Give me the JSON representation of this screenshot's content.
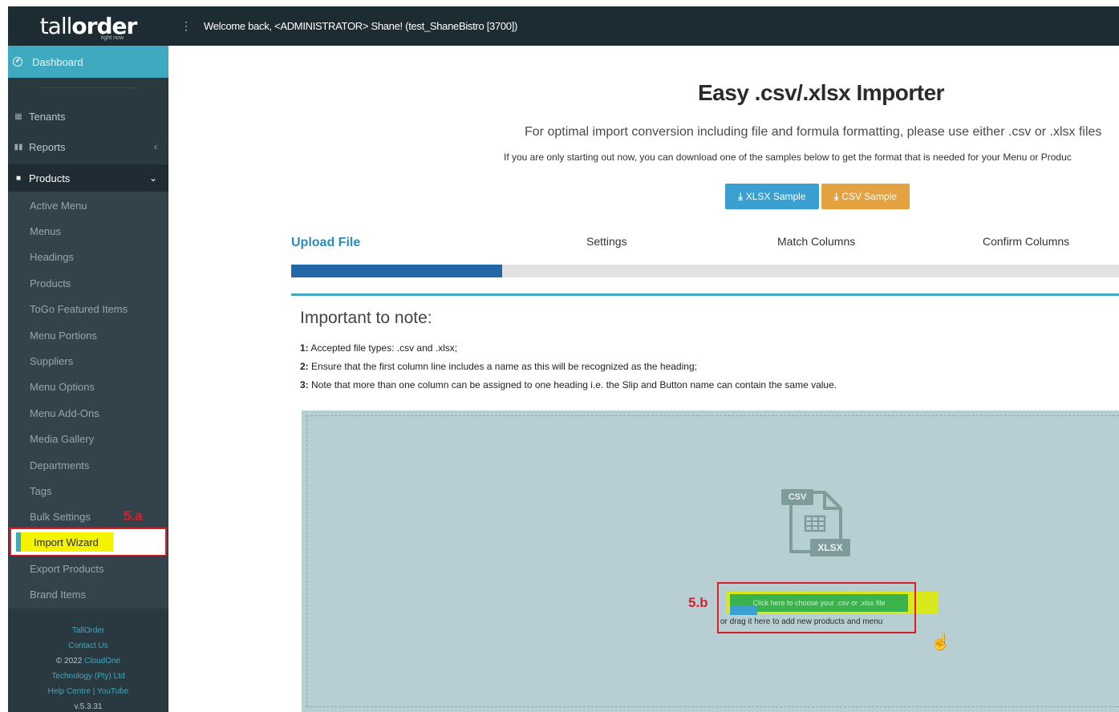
{
  "header": {
    "logo_tall": "tall",
    "logo_order": "order",
    "logo_sub": "right now",
    "menu_glyph": "⋮",
    "welcome": "Welcome back, <ADMINISTRATOR> Shane! (test_ShaneBistro [3700])"
  },
  "sidebar": {
    "dashboard": "Dashboard",
    "tenants": "Tenants",
    "reports": "Reports",
    "products_section": "Products",
    "sub_items": [
      "Active Menu",
      "Menus",
      "Headings",
      "Products",
      "ToGo Featured Items",
      "Menu Portions",
      "Suppliers",
      "Menu Options",
      "Menu Add-Ons",
      "Media Gallery",
      "Departments",
      "Tags",
      "Bulk Settings"
    ],
    "import_wizard": "Import Wizard",
    "after_items": [
      "Export Products",
      "Brand Items"
    ],
    "annotation_a": "5.a",
    "footer": {
      "tallorder": "TallOrder",
      "contact": "Contact Us",
      "copyright": "© 2022",
      "company": "CloudOne",
      "company2": "Technology (Pty) Ltd",
      "help": "Help Centre | YouTube",
      "version": "v.5.3.31"
    }
  },
  "main": {
    "title": "Easy .csv/.xlsx Importer",
    "subtitle": "For optimal import conversion including file and formula formatting, please use either .csv or .xlsx files",
    "note": "If you are only starting out now, you can download one of the samples below to get the format that is needed for your Menu or Produc",
    "xlsx_button": "XLSX Sample",
    "csv_button": "CSV Sample",
    "steps": [
      "Upload File",
      "Settings",
      "Match Columns",
      "Confirm Columns"
    ],
    "progress_fraction": 0.255,
    "important_title": "Important to note:",
    "notes": [
      {
        "num": "1:",
        "text": "Accepted file types: .csv and .xlsx;"
      },
      {
        "num": "2:",
        "text": "Ensure that the first column line includes a name as this will be recognized as the heading;"
      },
      {
        "num": "3:",
        "text": "Note that more than one column can be assigned to one heading i.e. the Slip and Button name can contain the same value."
      }
    ],
    "dropzone": {
      "csv_tag": "CSV",
      "xlsx_tag": "XLSX",
      "choose_label": "Click here to choose your .csv or .xlsx file",
      "drag_text": "or drag it here to add new products and menu",
      "annotation_b": "5.b"
    }
  },
  "colors": {
    "accent": "#3fa9bf",
    "sidebar": "#2a3840",
    "topbar": "#1d2b33",
    "annotation_red": "#d9202a",
    "highlight_yellow": "#f3f300"
  }
}
